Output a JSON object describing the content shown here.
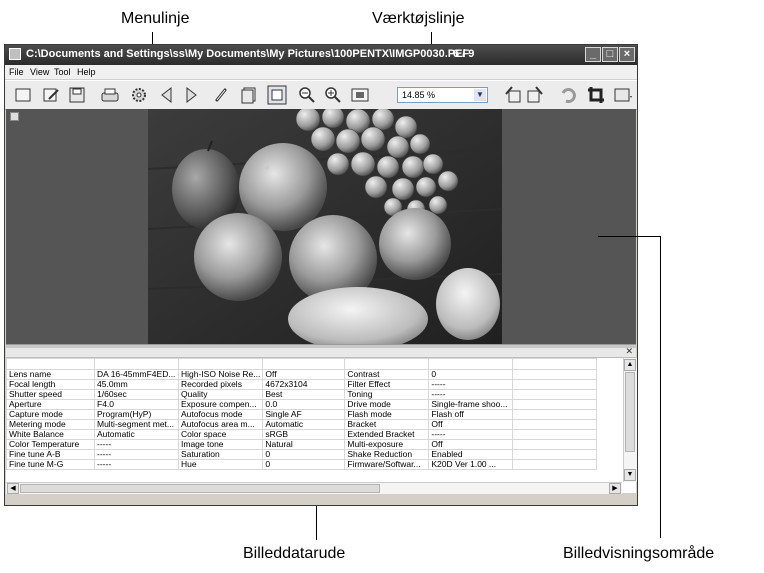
{
  "callouts": {
    "menu_bar": "Menulinje",
    "toolbar": "Værktøjslinje",
    "data_pane": "Billeddatarude",
    "view_area": "Billedvisningsområde"
  },
  "window": {
    "title": "C:\\Documents and Settings\\ss\\My Documents\\My Pictures\\100PENTX\\IMGP0030.PEF",
    "image_count": "6 / 9",
    "controls": {
      "minimize": "_",
      "maximize": "□",
      "close": "×"
    }
  },
  "menu": {
    "file": "File",
    "view": "View",
    "tool": "Tool",
    "help": "Help"
  },
  "toolbar": {
    "zoom_value": "14.85 %",
    "icons": [
      "new-window-icon",
      "edit-icon",
      "save-icon",
      "print-icon",
      "settings-icon",
      "previous-icon",
      "next-icon",
      "link-icon",
      "copy-icon",
      "fit-to-window-icon",
      "zoom-out-icon",
      "zoom-in-icon",
      "full-size-icon",
      "rotate-left-icon",
      "rotate-right-icon",
      "undo-icon",
      "crop-icon",
      "display-mode-icon"
    ]
  },
  "data_pane": {
    "rows": [
      [
        "Lens name",
        "DA 16-45mmF4ED...",
        "High-ISO Noise Re...",
        "Off",
        "Contrast",
        "0"
      ],
      [
        "Focal length",
        "45.0mm",
        "Recorded pixels",
        "4672x3104",
        "Filter Effect",
        "-----"
      ],
      [
        "Shutter speed",
        "1/60sec",
        "Quality",
        "Best",
        "Toning",
        "-----"
      ],
      [
        "Aperture",
        "F4.0",
        "Exposure compen...",
        "0.0",
        "Drive mode",
        "Single-frame shoo..."
      ],
      [
        "Capture mode",
        "Program(HyP)",
        "Autofocus mode",
        "Single AF",
        "Flash mode",
        "Flash off"
      ],
      [
        "Metering mode",
        "Multi-segment met...",
        "Autofocus area m...",
        "Automatic",
        "Bracket",
        "Off"
      ],
      [
        "White Balance",
        "Automatic",
        "Color space",
        "sRGB",
        "Extended Bracket",
        "-----"
      ],
      [
        "Color Temperature",
        "-----",
        "Image tone",
        "Natural",
        "Multi-exposure",
        "Off"
      ],
      [
        "Fine tune A-B",
        "-----",
        "Saturation",
        "0",
        "Shake Reduction",
        "Enabled"
      ],
      [
        "Fine tune M-G",
        "-----",
        "Hue",
        "0",
        "Firmware/Softwar...",
        "K20D Ver 1.00 ..."
      ]
    ]
  },
  "colors": {
    "view_background": "#555555",
    "title_bar": "#3a3a3a"
  }
}
